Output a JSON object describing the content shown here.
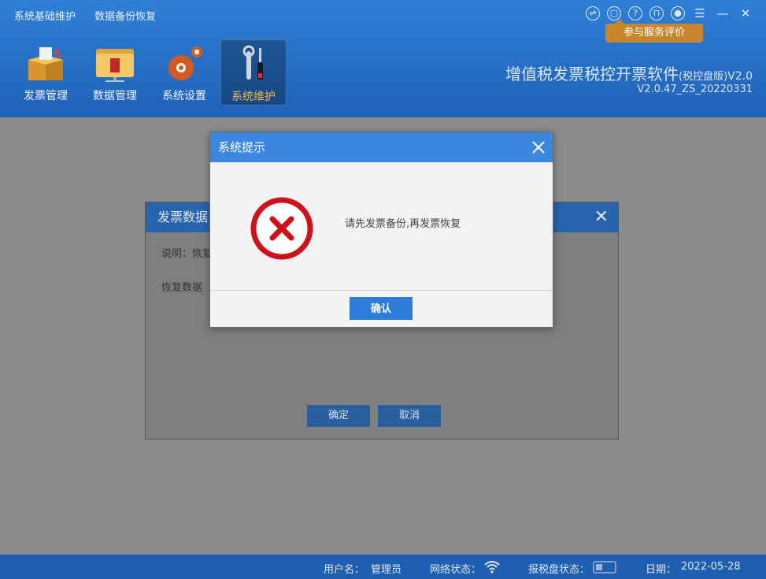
{
  "breadcrumb": [
    "系统基础维护",
    "数据备份恢复"
  ],
  "header": {
    "eval_button": "参与服务评价",
    "app_title": "增值税发票税控开票软件",
    "app_title_suffix": "(税控盘版)",
    "app_title_ver": "V2.0",
    "app_version": "V2.0.47_ZS_20220331",
    "window_controls": [
      "exchange-icon",
      "feedback-icon",
      "help-icon",
      "lock-icon",
      "user-icon",
      "menu-icon",
      "minimize-icon",
      "close-icon"
    ]
  },
  "nav": [
    {
      "label": "发票管理",
      "icon": "invoice-box-icon"
    },
    {
      "label": "数据管理",
      "icon": "data-folder-icon"
    },
    {
      "label": "系统设置",
      "icon": "gear-icon"
    },
    {
      "label": "系统维护",
      "icon": "tools-icon",
      "active": true
    }
  ],
  "under_dialog": {
    "title": "发票数据",
    "desc": "说明：恢复",
    "field": "恢复数据",
    "ok": "确定",
    "cancel": "取消"
  },
  "modal": {
    "title": "系统提示",
    "message": "请先发票备份,再发票恢复",
    "ok": "确认",
    "icon": "error-icon"
  },
  "status": {
    "user_label": "用户名：",
    "user": "管理员",
    "network_label": "网络状态：",
    "disk_label": "报税盘状态：",
    "date_label": "日期：",
    "date": "2022-05-28"
  },
  "colors": {
    "header": "#2670c8",
    "modal_title": "#3a86e0",
    "error": "#d0101b",
    "accent": "#c9852b"
  }
}
